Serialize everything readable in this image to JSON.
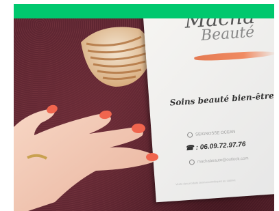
{
  "image": {
    "colors": {
      "banner": "#00c86e",
      "towel": "#5a2530",
      "nail_polish": "#f0654e",
      "card": "#f2f1ee"
    }
  },
  "card": {
    "title_line1": "Macha",
    "title_line2": "Beauté",
    "tagline": "Soins beauté bien-être",
    "address": "SEIGNOSSE OCEAN",
    "phone": "☎ : 06.09.72.97.76",
    "email": "machabeaute@outlook.com",
    "footer": "Vente des produits dermocosmétiques au cabinet"
  }
}
